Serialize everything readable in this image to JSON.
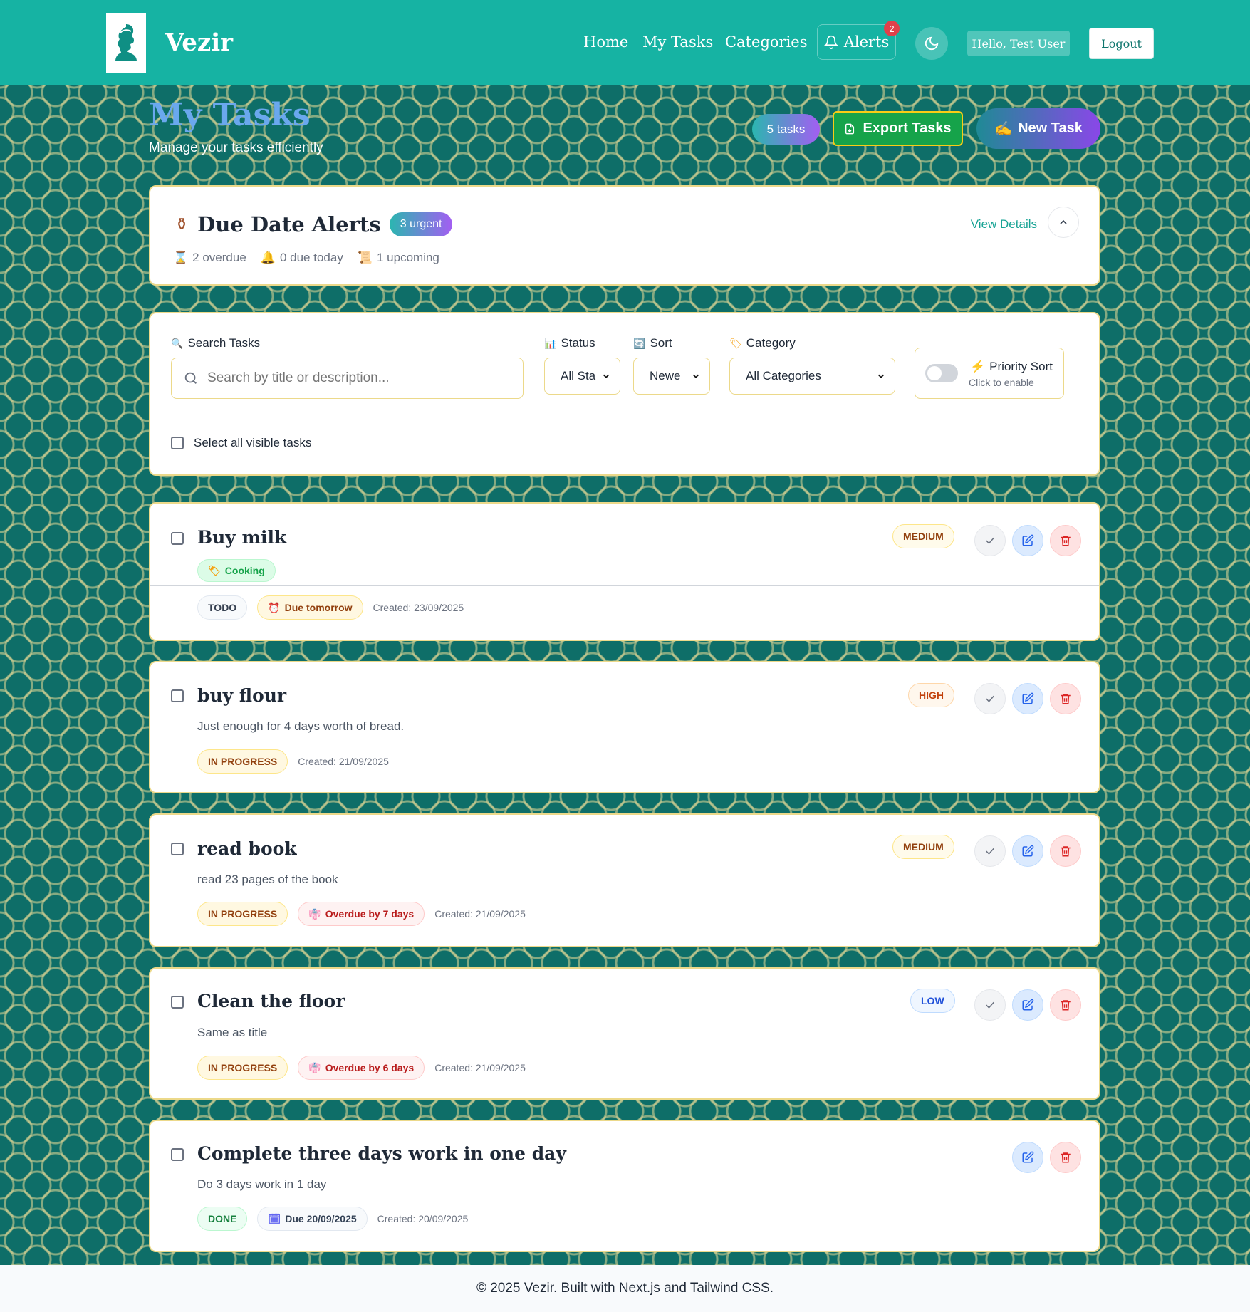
{
  "header": {
    "brand": "Vezir",
    "nav": [
      "Home",
      "My Tasks",
      "Categories"
    ],
    "alerts_label": "Alerts",
    "alerts_count": "2",
    "greeting": "Hello, Test User",
    "logout": "Logout",
    "accent_color": "#16b3a3"
  },
  "page": {
    "title": "My Tasks",
    "subtitle": "Manage your tasks efficiently",
    "task_count": "5 tasks",
    "export_label": "Export Tasks",
    "new_task_label": "New Task"
  },
  "alerts": {
    "title": "Due Date Alerts",
    "urgent": "3 urgent",
    "overdue": "2 overdue",
    "due_today": "0 due today",
    "upcoming": "1 upcoming",
    "view_details": "View Details"
  },
  "filters": {
    "search_label": "Search Tasks",
    "search_placeholder": "Search by title or description...",
    "status_label": "Status",
    "status_value": "All Sta",
    "sort_label": "Sort",
    "sort_value": "Newe",
    "category_label": "Category",
    "category_value": "All Categories",
    "priority_sort_label": "Priority Sort",
    "priority_sort_hint": "Click to enable",
    "select_all": "Select all visible tasks"
  },
  "tasks": [
    {
      "title": "Buy milk",
      "category": "Cooking",
      "priority": "MEDIUM",
      "status": "TODO",
      "due": "Due tomorrow",
      "created": "Created: 23/09/2025"
    },
    {
      "title": "buy flour",
      "description": "Just enough for 4 days worth of bread.",
      "priority": "HIGH",
      "status": "IN PROGRESS",
      "created": "Created: 21/09/2025"
    },
    {
      "title": "read book",
      "description": "read 23 pages of the book",
      "priority": "MEDIUM",
      "status": "IN PROGRESS",
      "due": "Overdue by 7 days",
      "created": "Created: 21/09/2025"
    },
    {
      "title": "Clean the floor",
      "description": "Same as title",
      "priority": "LOW",
      "status": "IN PROGRESS",
      "due": "Overdue by 6 days",
      "created": "Created: 21/09/2025"
    },
    {
      "title": "Complete three days work in one day",
      "description": "Do 3 days work in 1 day",
      "status": "DONE",
      "due": "Due 20/09/2025",
      "created": "Created: 20/09/2025"
    }
  ],
  "footer": "© 2025 Vezir. Built with Next.js and Tailwind CSS."
}
